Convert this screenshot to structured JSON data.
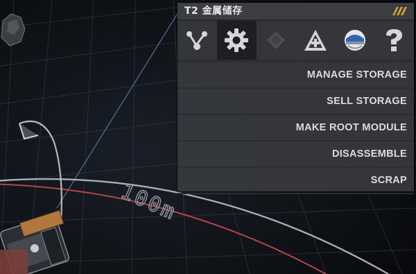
{
  "hud": {
    "distance_label": "100m"
  },
  "panel": {
    "title": "T2 金属储存",
    "accent_color": "#d6a23a",
    "tabs": [
      {
        "name": "connection",
        "icon": "node-graph-icon",
        "active": false,
        "enabled": true
      },
      {
        "name": "settings",
        "icon": "gear-icon",
        "active": true,
        "enabled": true
      },
      {
        "name": "blueprint",
        "icon": "diamond-icon",
        "active": false,
        "enabled": false
      },
      {
        "name": "upgrade",
        "icon": "pyramid-plus-icon",
        "active": false,
        "enabled": true
      },
      {
        "name": "crew",
        "icon": "helmet-icon",
        "active": false,
        "enabled": true
      },
      {
        "name": "help",
        "icon": "question-icon",
        "active": false,
        "enabled": true
      }
    ],
    "menu": [
      {
        "label": "MANAGE STORAGE"
      },
      {
        "label": "SELL STORAGE"
      },
      {
        "label": "MAKE ROOT MODULE"
      },
      {
        "label": "DISASSEMBLE"
      },
      {
        "label": "SCRAP"
      }
    ]
  }
}
